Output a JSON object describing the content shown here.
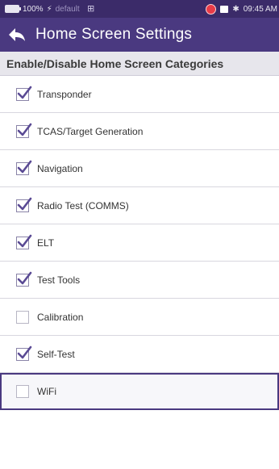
{
  "status_bar": {
    "battery": "100%",
    "profile": "default",
    "time": "09:45 AM"
  },
  "title_bar": {
    "title": "Home Screen Settings",
    "back_icon": "back-arrow-icon"
  },
  "section": {
    "header": "Enable/Disable Home Screen Categories"
  },
  "categories": [
    {
      "label": "Transponder",
      "checked": true
    },
    {
      "label": "TCAS/Target Generation",
      "checked": true
    },
    {
      "label": "Navigation",
      "checked": true
    },
    {
      "label": "Radio Test (COMMS)",
      "checked": true
    },
    {
      "label": "ELT",
      "checked": true
    },
    {
      "label": "Test Tools",
      "checked": true
    },
    {
      "label": "Calibration",
      "checked": false
    },
    {
      "label": "Self-Test",
      "checked": true
    },
    {
      "label": "WiFi",
      "checked": false
    }
  ],
  "colors": {
    "status_bar_bg": "#3b2b69",
    "title_bar_bg": "#4a3980",
    "checkmark": "#5a4a94",
    "selected_border": "#4a3980"
  }
}
